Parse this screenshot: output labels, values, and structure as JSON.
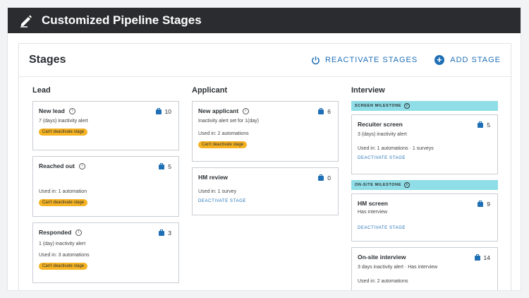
{
  "app": {
    "title": "Customized Pipeline Stages",
    "icon": "pen-icon"
  },
  "panel": {
    "title": "Stages",
    "reactivate_label": "REACTIVATE STAGES",
    "add_label": "ADD STAGE"
  },
  "colors": {
    "accent": "#1f6fb5",
    "badge": "#f5b323",
    "milestone": "#8fdde6",
    "topbar": "#2a2c2f"
  },
  "columns": [
    {
      "title": "Lead",
      "cards": [
        {
          "name": "New lead",
          "count": "10",
          "alert": "7 (days) inactivity alert",
          "badge": "Can't deactivate stage"
        },
        {
          "name": "Reached out",
          "count": "5",
          "used": "Used in: 1 automation",
          "badge": "Can't deactivate stage"
        },
        {
          "name": "Responded",
          "count": "3",
          "alert": "1 (day) inactivity alert",
          "used": "Used in: 3 automations",
          "badge": "Can't deactivate stage"
        }
      ]
    },
    {
      "title": "Applicant",
      "cards": [
        {
          "name": "New applicant",
          "count": "6",
          "alert": "Inactivity alert set for 1(day)",
          "used": "Used in: 2 automations",
          "badge": "Can't deactivate stage"
        },
        {
          "name": "HM review",
          "count": "0",
          "used": "Used in: 1 survey",
          "action": "DEACTIVATE STAGE"
        }
      ]
    },
    {
      "title": "Interview",
      "milestones": [
        {
          "label": "SCREEN MILESTONE"
        },
        {
          "label": "ON-SITE MILESTONE"
        }
      ],
      "cards": [
        {
          "name": "Recuiter screen",
          "count": "5",
          "alert": "3 (days) inactivity alert",
          "used": "Used in: 1 automations  · 1 surveys",
          "action": "DEACTIVATE STAGE"
        },
        {
          "name": "HM screen",
          "count": "9",
          "alert": "Has interview",
          "action": "DEACTIVATE STAGE"
        },
        {
          "name": "On-site interview",
          "count": "14",
          "alert": "3 days inactivity alert · Has interview",
          "used": "Used in: 2 automations"
        }
      ]
    }
  ]
}
